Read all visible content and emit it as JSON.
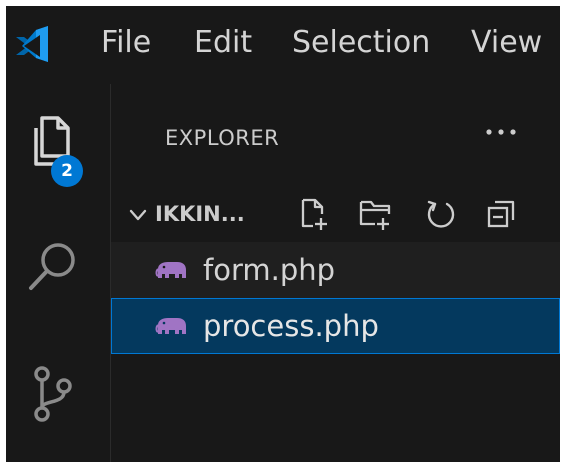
{
  "menu": {
    "file": "File",
    "edit": "Edit",
    "selection": "Selection",
    "view": "View"
  },
  "activity_bar": {
    "explorer_badge": "2",
    "icons": [
      "explorer-icon",
      "search-icon",
      "source-control-icon"
    ]
  },
  "explorer": {
    "title": "EXPLORER",
    "folder": {
      "name": "IKKIN...",
      "expanded": true
    },
    "toolbar_icons": [
      "new-file-icon",
      "new-folder-icon",
      "refresh-icon",
      "collapse-all-icon"
    ],
    "files": [
      {
        "name": "form.php",
        "icon": "php-elephant-icon",
        "selected": false
      },
      {
        "name": "process.php",
        "icon": "php-elephant-icon",
        "selected": true
      }
    ]
  },
  "colors": {
    "background": "#181818",
    "accent": "#0078d4",
    "selection": "#04395e",
    "php_icon": "#a074c4"
  }
}
